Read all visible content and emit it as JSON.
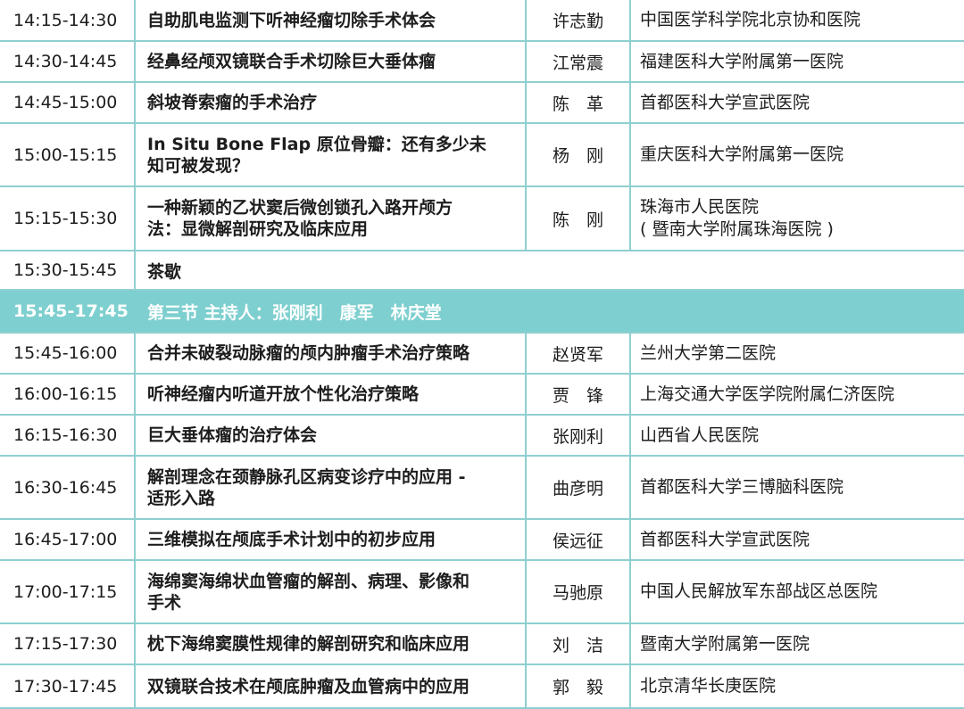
{
  "rows": [
    {
      "time": "14:15-14:30",
      "topic": [
        "自助肌电监测下听神经瘤切除手术体会"
      ],
      "speaker": "许志勤",
      "institution": [
        "中国医学科学院北京协和医院"
      ]
    },
    {
      "time": "14:30-14:45",
      "topic": [
        "经鼻经颅双镜联合手术切除巨大垂体瘤"
      ],
      "speaker": "江常震",
      "institution": [
        "福建医科大学附属第一医院"
      ]
    },
    {
      "time": "14:45-15:00",
      "topic": [
        "斜坡脊索瘤的手术治疗"
      ],
      "speaker": "陈　革",
      "institution": [
        "首都医科大学宣武医院"
      ]
    },
    {
      "time": "15:00-15:15",
      "topic": [
        "In Situ Bone Flap 原位骨瓣：还有多少未",
        "知可被发现？"
      ],
      "speaker": "杨　刚",
      "institution": [
        "重庆医科大学附属第一医院"
      ]
    },
    {
      "time": "15:15-15:30",
      "topic": [
        "一种新颖的乙状窦后微创锁孔入路开颅方",
        "法：显微解剖研究及临床应用"
      ],
      "speaker": "陈　刚",
      "institution": [
        "珠海市人民医院",
        "( 暨南大学附属珠海医院 )"
      ]
    },
    {
      "time": "15:30-15:45",
      "topic": [
        "茶歇"
      ],
      "speaker": "",
      "institution": []
    },
    {
      "time": "15:45-17:45",
      "session": "第三节 主持人：张刚利　康军　林庆堂"
    },
    {
      "time": "15:45-16:00",
      "topic": [
        "合并未破裂动脉瘤的颅内肿瘤手术治疗策略"
      ],
      "speaker": "赵贤军",
      "institution": [
        "兰州大学第二医院"
      ]
    },
    {
      "time": "16:00-16:15",
      "topic": [
        "听神经瘤内听道开放个性化治疗策略"
      ],
      "speaker": "贾　锋",
      "institution": [
        "上海交通大学医学院附属仁济医院"
      ]
    },
    {
      "time": "16:15-16:30",
      "topic": [
        "巨大垂体瘤的治疗体会"
      ],
      "speaker": "张刚利",
      "institution": [
        "山西省人民医院"
      ]
    },
    {
      "time": "16:30-16:45",
      "topic": [
        "解剖理念在颈静脉孔区病变诊疗中的应用 -",
        "适形入路"
      ],
      "speaker": "曲彦明",
      "institution": [
        "首都医科大学三博脑科医院"
      ]
    },
    {
      "time": "16:45-17:00",
      "topic": [
        "三维模拟在颅底手术计划中的初步应用"
      ],
      "speaker": "侯远征",
      "institution": [
        "首都医科大学宣武医院"
      ]
    },
    {
      "time": "17:00-17:15",
      "topic": [
        "海绵窦海绵状血管瘤的解剖、病理、影像和",
        "手术"
      ],
      "speaker": "马驰原",
      "institution": [
        "中国人民解放军东部战区总医院"
      ]
    },
    {
      "time": "17:15-17:30",
      "topic": [
        "枕下海绵窦膜性规律的解剖研究和临床应用"
      ],
      "speaker": "刘　洁",
      "institution": [
        "暨南大学附属第一医院"
      ]
    },
    {
      "time": "17:30-17:45",
      "topic": [
        "双镜联合技术在颅底肿瘤及血管病中的应用"
      ],
      "speaker": "郭　毅",
      "institution": [
        "北京清华长庚医院"
      ]
    }
  ]
}
